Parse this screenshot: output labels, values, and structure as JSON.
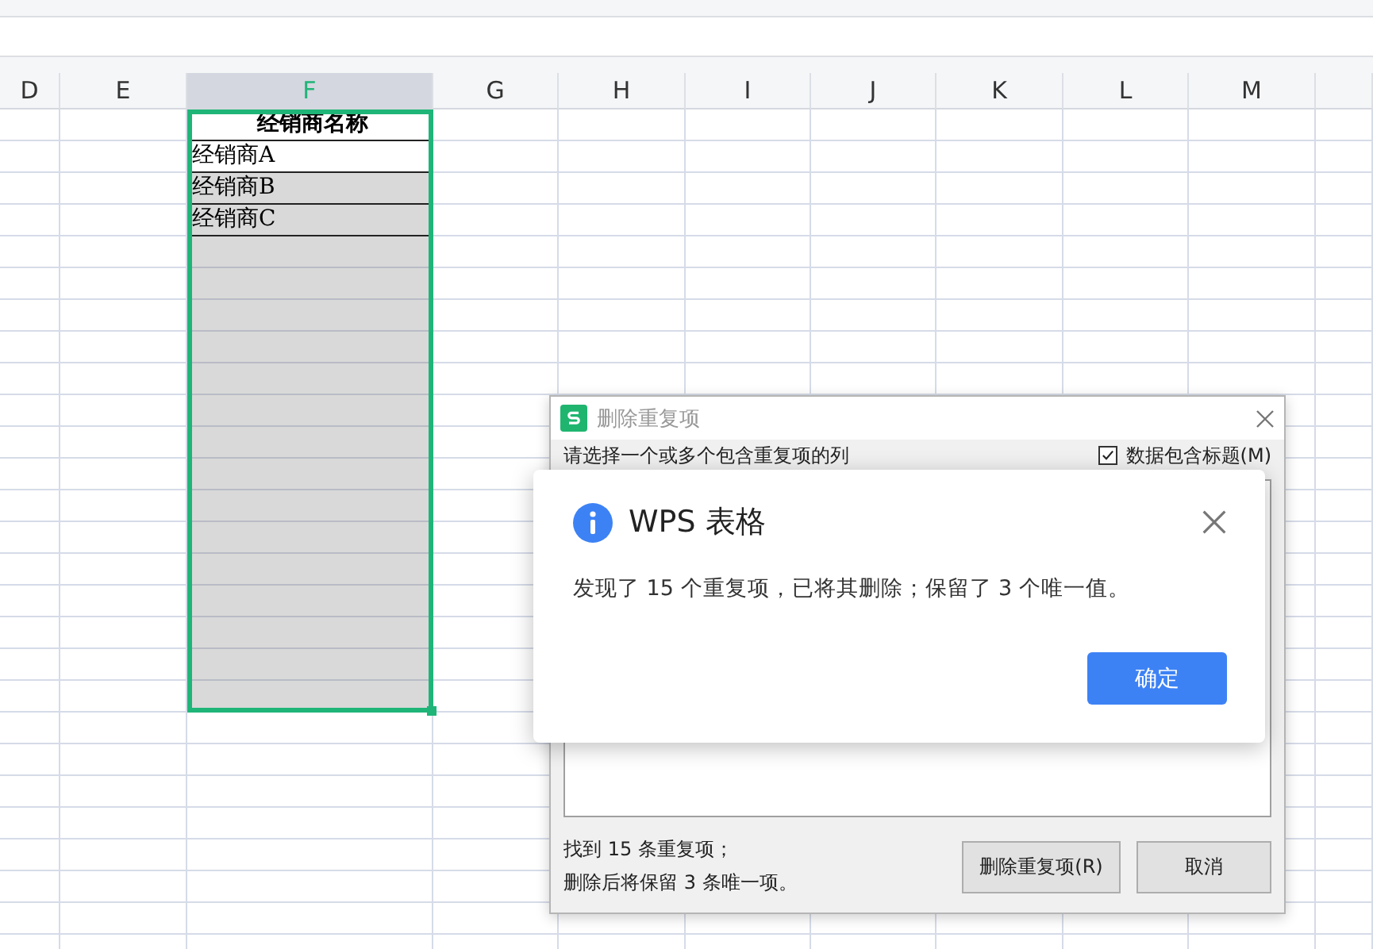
{
  "columns": [
    {
      "label": "D",
      "selected": false
    },
    {
      "label": "E",
      "selected": false
    },
    {
      "label": "F",
      "selected": true
    },
    {
      "label": "G",
      "selected": false
    },
    {
      "label": "H",
      "selected": false
    },
    {
      "label": "I",
      "selected": false
    },
    {
      "label": "J",
      "selected": false
    },
    {
      "label": "K",
      "selected": false
    },
    {
      "label": "L",
      "selected": false
    },
    {
      "label": "M",
      "selected": false
    }
  ],
  "f_cells": [
    {
      "kind": "header",
      "text": "经销商名称",
      "highlighted": false
    },
    {
      "kind": "data",
      "text": "经销商A",
      "highlighted": false
    },
    {
      "kind": "data",
      "text": "经销商B",
      "highlighted": true
    },
    {
      "kind": "data",
      "text": "经销商C",
      "highlighted": true
    },
    {
      "kind": "blank",
      "highlighted": true
    },
    {
      "kind": "blank",
      "highlighted": true
    },
    {
      "kind": "blank",
      "highlighted": true
    },
    {
      "kind": "blank",
      "highlighted": true
    },
    {
      "kind": "blank",
      "highlighted": true
    },
    {
      "kind": "blank",
      "highlighted": true
    },
    {
      "kind": "blank",
      "highlighted": true
    },
    {
      "kind": "blank",
      "highlighted": true
    },
    {
      "kind": "blank",
      "highlighted": true
    },
    {
      "kind": "blank",
      "highlighted": true
    },
    {
      "kind": "blank",
      "highlighted": true
    },
    {
      "kind": "blank",
      "highlighted": true
    },
    {
      "kind": "blank",
      "highlighted": true
    },
    {
      "kind": "blank",
      "highlighted": true
    },
    {
      "kind": "blank",
      "highlighted": true
    }
  ],
  "dialog": {
    "title": "删除重复项",
    "prompt": "请选择一个或多个包含重复项的列",
    "header_checkbox": {
      "label": "数据包含标题(M)",
      "checked": true
    },
    "summary": [
      "找到 15 条重复项；",
      "删除后将保留 3 条唯一项。"
    ],
    "buttons": [
      "删除重复项(R)",
      "取消"
    ]
  },
  "message_box": {
    "title": "WPS 表格",
    "message": "发现了 15 个重复项，已将其删除；保留了 3 个唯一值。",
    "button": "确定"
  }
}
